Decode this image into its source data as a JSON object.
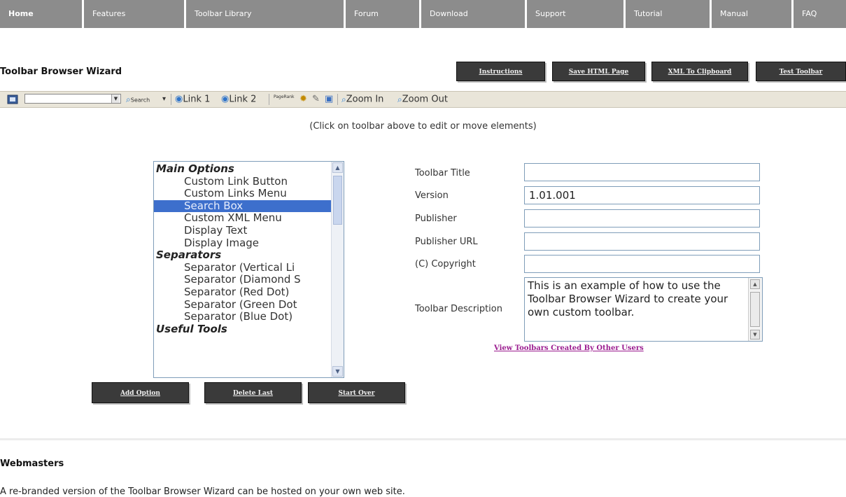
{
  "nav": [
    "Home",
    "Features",
    "Toolbar Library",
    "Forum",
    "Download",
    "Support",
    "Tutorial",
    "Manual",
    "FAQ"
  ],
  "header": {
    "title": "Toolbar Browser Wizard",
    "buttons": [
      "Instructions",
      "Save HTML Page",
      "XML To Clipboard",
      "Test Toolbar"
    ]
  },
  "toolbar": {
    "search_label": "Search",
    "link1": "Link 1",
    "link2": "Link 2",
    "pagerank": "PageRank",
    "zoom_in": "Zoom In",
    "zoom_out": "Zoom Out",
    "icons": [
      "toolbar-logo-icon",
      "dropdown-arrow-icon",
      "search-icon",
      "ie-page-icon",
      "pagerank-icon",
      "highlight-icon",
      "edit-icon",
      "popup-icon",
      "zoom-icon"
    ]
  },
  "hint": "(Click on toolbar above to edit or move elements)",
  "options_list": [
    {
      "label": "Main Options",
      "group": true
    },
    {
      "label": "Custom Link Button",
      "group": false
    },
    {
      "label": "Custom Links Menu",
      "group": false
    },
    {
      "label": "Search Box",
      "group": false,
      "selected": true
    },
    {
      "label": "Custom XML Menu",
      "group": false
    },
    {
      "label": "Display Text",
      "group": false
    },
    {
      "label": "Display Image",
      "group": false
    },
    {
      "label": "Separators",
      "group": true
    },
    {
      "label": "Separator (Vertical Li",
      "group": false
    },
    {
      "label": "Separator (Diamond S",
      "group": false
    },
    {
      "label": "Separator (Red Dot)",
      "group": false
    },
    {
      "label": "Separator (Green Dot",
      "group": false
    },
    {
      "label": "Separator (Blue Dot)",
      "group": false
    },
    {
      "label": "Useful Tools",
      "group": true
    }
  ],
  "list_buttons": [
    "Add Option",
    "Delete Last",
    "Start Over"
  ],
  "form": {
    "title_label": "Toolbar Title",
    "title_value": "",
    "version_label": "Version",
    "version_value": "1.01.001",
    "publisher_label": "Publisher",
    "publisher_value": "",
    "publisher_url_label": "Publisher URL",
    "publisher_url_value": "",
    "copyright_label": "(C) Copyright",
    "copyright_value": "",
    "description_label": "Toolbar Description",
    "description_value": "This is an example of how to use the Toolbar Browser Wizard to create your own custom toolbar."
  },
  "view_link": "View Toolbars Created By Other Users",
  "webmasters": {
    "heading": "Webmasters",
    "text": "A re-branded version of the Toolbar Browser Wizard can be hosted on your own web site."
  },
  "colors": {
    "nav_bg": "#8c8c8c",
    "button_bg": "#3a3a3a",
    "selection": "#3d6fcc",
    "link": "#9b1c8f",
    "toolbar_bg": "#e9e5d9"
  }
}
